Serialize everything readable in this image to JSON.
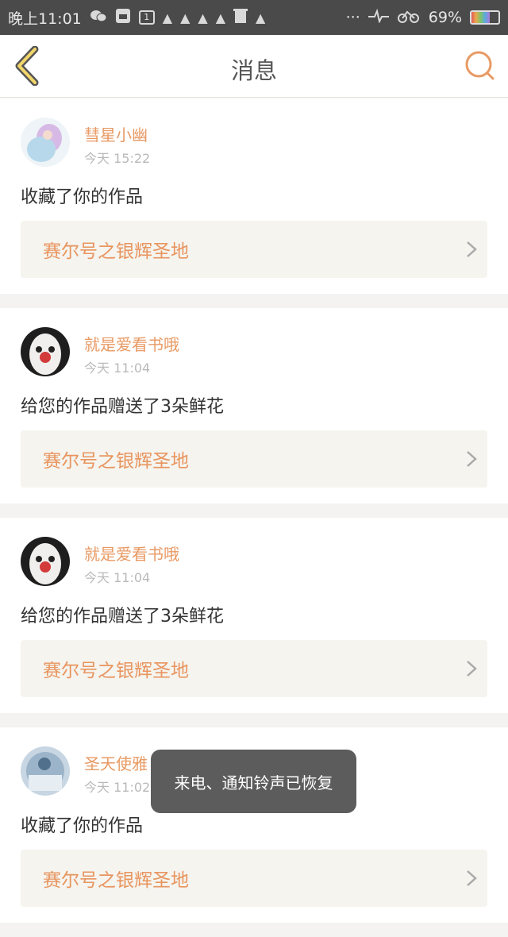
{
  "status_bar": {
    "time": "晚上11:01",
    "calendar_day": "1",
    "dots": "···",
    "battery": "69%",
    "battery_level": 0.69
  },
  "nav": {
    "title": "消息"
  },
  "messages": [
    {
      "user": "彗星小幽",
      "time": "今天 15:22",
      "action": "收藏了你的作品",
      "work": "赛尔号之银辉圣地"
    },
    {
      "user": "就是爱看书哦",
      "time": "今天 11:04",
      "action": "给您的作品赠送了3朵鲜花",
      "work": "赛尔号之银辉圣地"
    },
    {
      "user": "就是爱看书哦",
      "time": "今天 11:04",
      "action": "给您的作品赠送了3朵鲜花",
      "work": "赛尔号之银辉圣地"
    },
    {
      "user": "圣天使雅",
      "time": "今天 11:02",
      "action": "收藏了你的作品",
      "work": "赛尔号之银辉圣地"
    }
  ],
  "toast": {
    "text": "来电、通知铃声已恢复"
  },
  "colors": {
    "accent": "#e89a64",
    "status_bar": "#4a4a4a"
  }
}
